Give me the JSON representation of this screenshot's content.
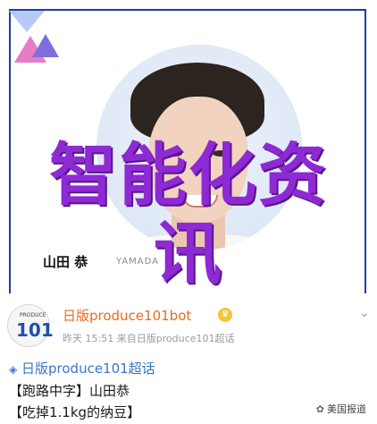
{
  "card": {
    "name_label": "山田 恭",
    "watermark": "YAMADA",
    "overlay_title": "智能化资讯"
  },
  "post": {
    "avatar_top": "PRODUCE",
    "avatar_num": "101",
    "username": "日版produce101bot",
    "verified_icon": "crown-badge-icon",
    "meta": "昨天 15:51  来自日版produce101超话",
    "topic_icon": "diamond-icon",
    "topic": "日版produce101超话",
    "line2": "【跑路中字】山田恭",
    "line3": "【吃掉1.1kg的纳豆】"
  },
  "watermark": {
    "icon": "wechat-icon",
    "text": "美国报道"
  },
  "colors": {
    "border": "#1f3e9c",
    "overlay": "#8e2ad4",
    "username": "#e86b1f",
    "link": "#3a74c7"
  }
}
